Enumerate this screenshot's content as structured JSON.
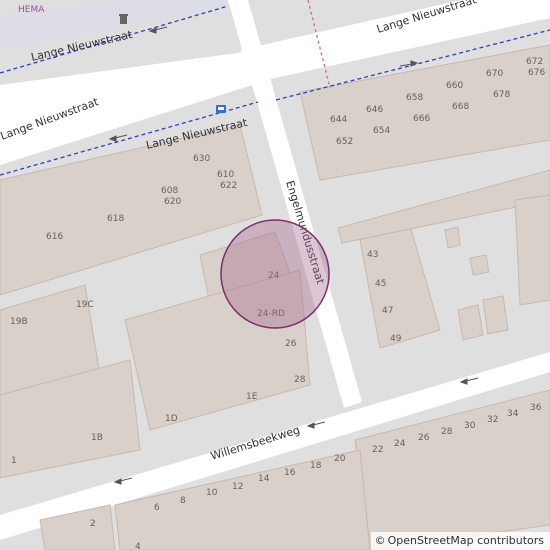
{
  "map": {
    "colors": {
      "background": "#e0dfdf",
      "road": "#ffffff",
      "building": "#d9d0c9",
      "building_outline": "#c6b9ae",
      "bus_route": "#2a3fc9",
      "rail": "#e06b6b",
      "marker_fill": "#a5678f",
      "marker_stroke": "#7b2f69"
    },
    "streets": {
      "lange_nieuwstraat_top": "Lange Nieuwstraat",
      "lange_nieuwstraat_left": "Lange Nieuwstraat",
      "lange_nieuwstraat_mid": "Lange Nieuwstraat",
      "engelmundusstraat": "Engelmundusstraat",
      "willemsbeekweg": "Willemsbeekweg"
    },
    "poi": {
      "hema": "HEMA",
      "bus_icon": "bus-stop-icon",
      "waste_icon": "waste-basket-icon"
    },
    "house_numbers": [
      "644",
      "646",
      "658",
      "660",
      "670",
      "672",
      "676",
      "652",
      "654",
      "666",
      "668",
      "678",
      "630",
      "610",
      "622",
      "608",
      "620",
      "618",
      "616",
      "43",
      "45",
      "47",
      "49",
      "24",
      "24-RD",
      "26",
      "28",
      "1E",
      "1D",
      "19C",
      "19B",
      "1B",
      "1",
      "22",
      "24",
      "26",
      "28",
      "30",
      "32",
      "34",
      "36",
      "2",
      "4",
      "6",
      "8",
      "10",
      "12",
      "14",
      "16",
      "18",
      "20"
    ],
    "marker": {
      "label": "selected-address"
    }
  },
  "attribution": {
    "symbol": "©",
    "text": "OpenStreetMap contributors"
  }
}
